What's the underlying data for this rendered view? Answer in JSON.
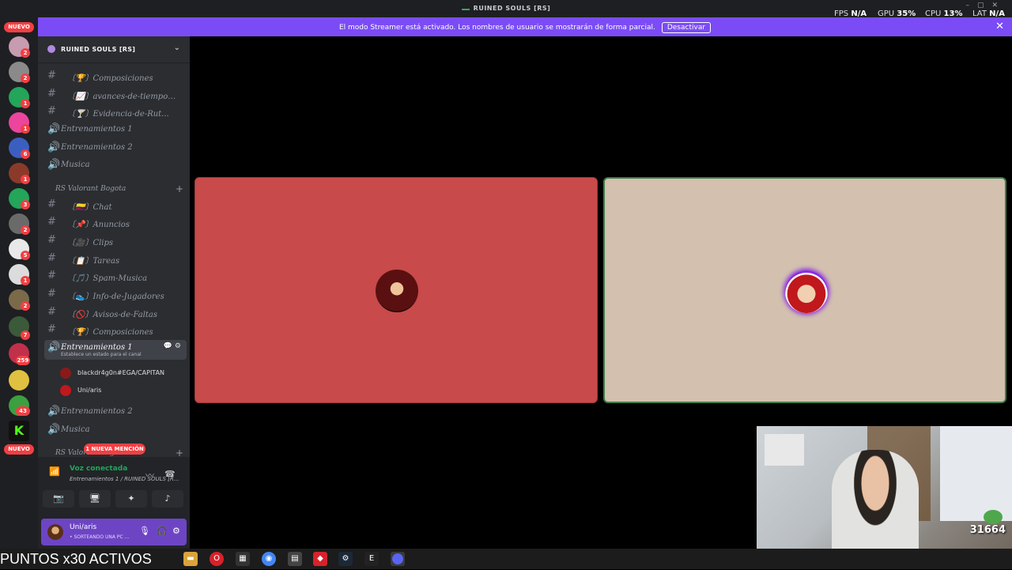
{
  "window": {
    "title": "RUINED SOULS [RS]",
    "perf": [
      {
        "label": "FPS",
        "value": "N/A"
      },
      {
        "label": "GPU",
        "value": "35%"
      },
      {
        "label": "CPU",
        "value": "13%"
      },
      {
        "label": "LAT",
        "value": "N/A"
      }
    ]
  },
  "banner": {
    "message": "El modo Streamer está activado. Los nombres de usuario se mostrarán de forma parcial.",
    "button": "Desactivar",
    "close": "✕"
  },
  "guilds": {
    "new_top": "NUEVO",
    "new_bottom": "NUEVO",
    "badges": [
      "2",
      "2",
      "1",
      "1",
      "6",
      "1",
      "3",
      "2",
      "5",
      "1",
      "2",
      "7",
      "259",
      "",
      "43"
    ]
  },
  "server": {
    "name": "RUINED SOULS [RS]",
    "channels_top": [
      {
        "type": "text",
        "name": "〔🏆〕Composiciones"
      },
      {
        "type": "text",
        "name": "〔📈〕avances-de-tiempo-d..."
      },
      {
        "type": "text",
        "name": "〔🍸〕Evidencia-de-Rut..."
      },
      {
        "type": "voice",
        "name": "Entrenamientos 1"
      },
      {
        "type": "voice",
        "name": "Entrenamientos 2"
      },
      {
        "type": "voice",
        "name": "Musica"
      }
    ],
    "category": "RS Valorant Bogota",
    "channels_cat": [
      {
        "type": "text",
        "name": "〔🇨🇴〕Chat"
      },
      {
        "type": "text",
        "name": "〔📌〕Anuncios"
      },
      {
        "type": "text",
        "name": "〔🎥〕Clips"
      },
      {
        "type": "text",
        "name": "〔📋〕Tareas"
      },
      {
        "type": "text",
        "name": "〔🎵〕Spam-Musica"
      },
      {
        "type": "text",
        "name": "〔👟〕Info-de-Jugadores"
      },
      {
        "type": "text",
        "name": "〔🚫〕Avisos-de-Faltas"
      },
      {
        "type": "text",
        "name": "〔🏆〕Composiciones"
      }
    ],
    "active_voice": {
      "name": "Entrenamientos 1",
      "status": "Establece un estado para el canal"
    },
    "voice_users": [
      {
        "name": "blackdr4g0n#EGA/CAPITAN"
      },
      {
        "name": "Uni/aris"
      }
    ],
    "channels_after": [
      {
        "type": "voice",
        "name": "Entrenamientos 2"
      },
      {
        "type": "voice",
        "name": "Musica"
      }
    ],
    "category_bottom": "RS Valorant Bogota",
    "mention": "1 NUEVA MENCIÓN"
  },
  "voice_panel": {
    "title": "Voz conectada",
    "subtitle": "Entrenamientos 1 / RUINED SOULS [R..."
  },
  "user": {
    "name": "Uni/aris",
    "status": "• SORTEANDO UNA PC ..."
  },
  "webcam": {
    "followers": "31664"
  },
  "taskbar": {
    "label": "PUNTOS x30 ACTIVOS"
  }
}
